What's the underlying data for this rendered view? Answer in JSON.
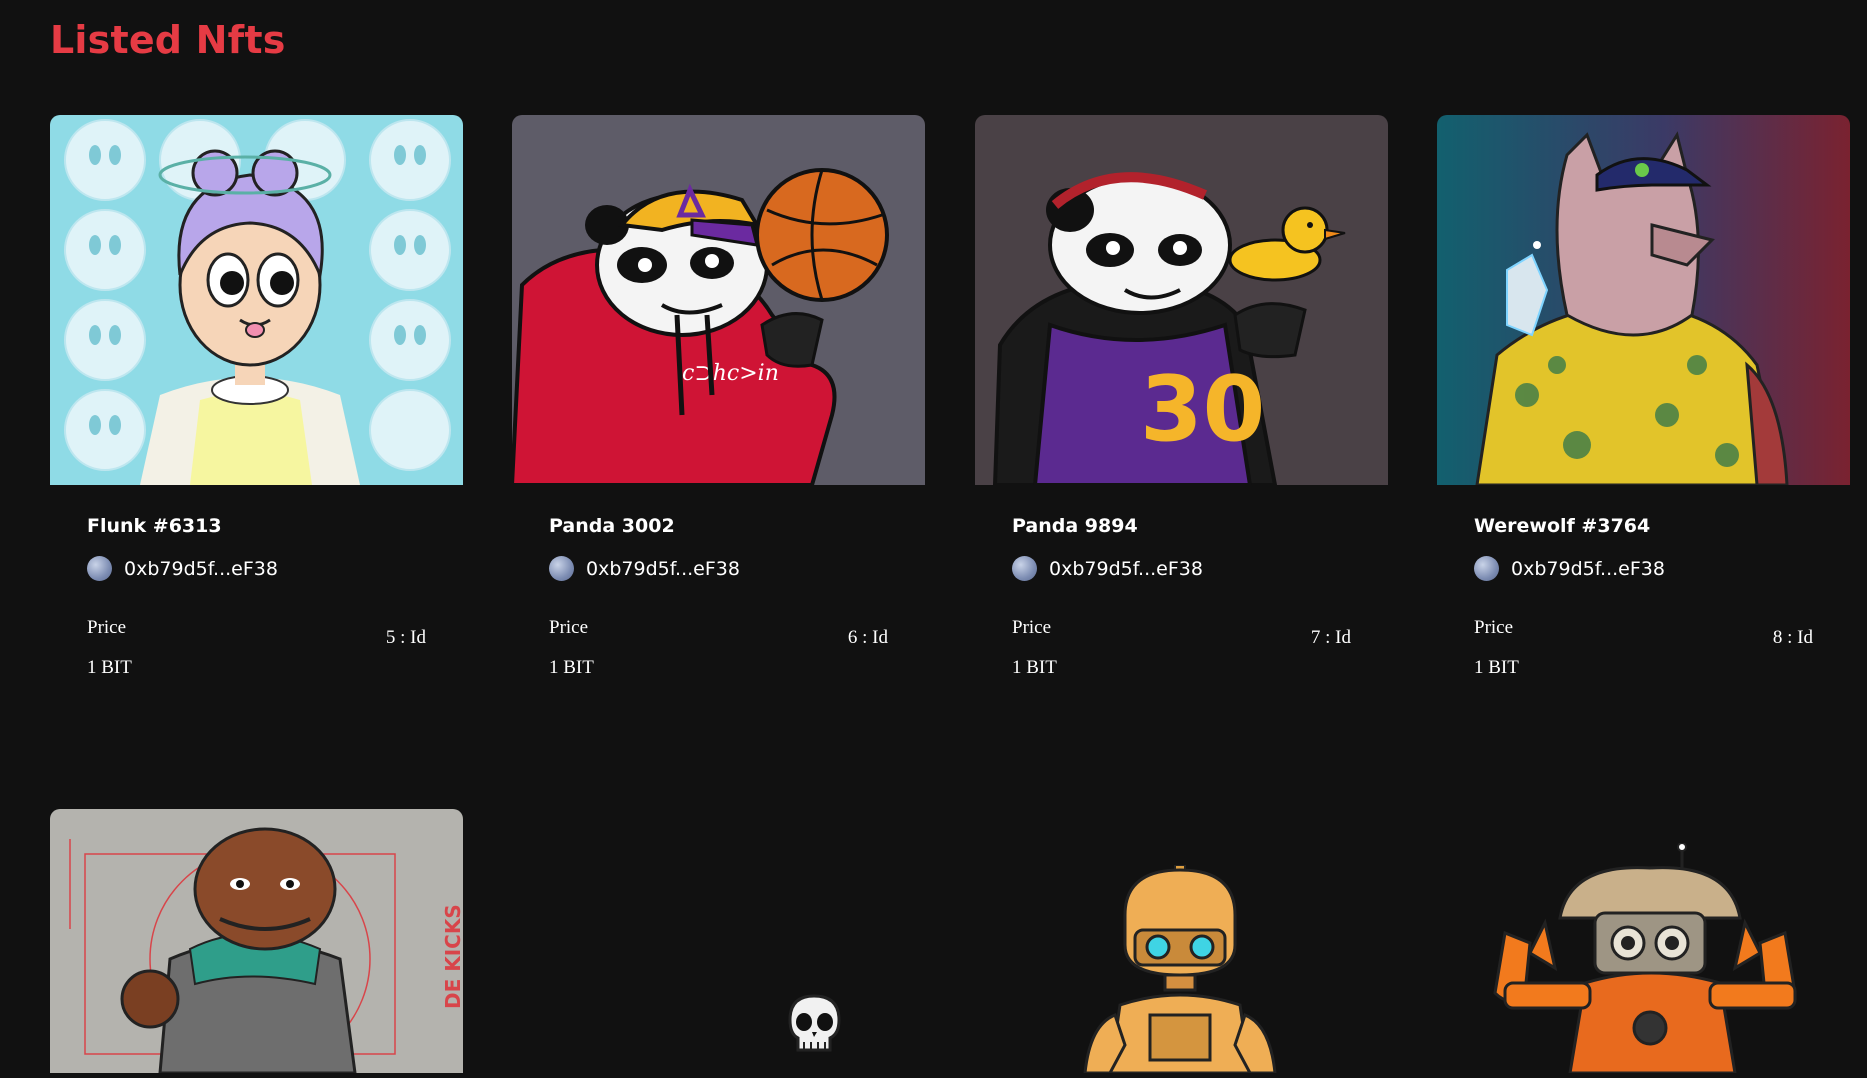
{
  "page": {
    "title": "Listed Nfts"
  },
  "cards": [
    {
      "name": "Flunk #6313",
      "owner": "0xb79d5f...eF38",
      "price_label": "Price",
      "price": "1 BIT",
      "id": "5 : Id"
    },
    {
      "name": "Panda 3002",
      "owner": "0xb79d5f...eF38",
      "price_label": "Price",
      "price": "1 BIT",
      "id": "6 : Id"
    },
    {
      "name": "Panda 9894",
      "owner": "0xb79d5f...eF38",
      "price_label": "Price",
      "price": "1 BIT",
      "id": "7 : Id"
    },
    {
      "name": "Werewolf #3764",
      "owner": "0xb79d5f...eF38",
      "price_label": "Price",
      "price": "1 BIT",
      "id": "8 : Id"
    }
  ],
  "colors": {
    "background": "#111111",
    "title": "#e63b44",
    "text": "#ffffff"
  },
  "art": {
    "second_row": [
      "bear-sneaker-art",
      "skull-icon",
      "robot-art",
      "mushroom-robot-art"
    ],
    "card1_jersey_number": "30",
    "card4_side_text": "DE KICKS"
  }
}
